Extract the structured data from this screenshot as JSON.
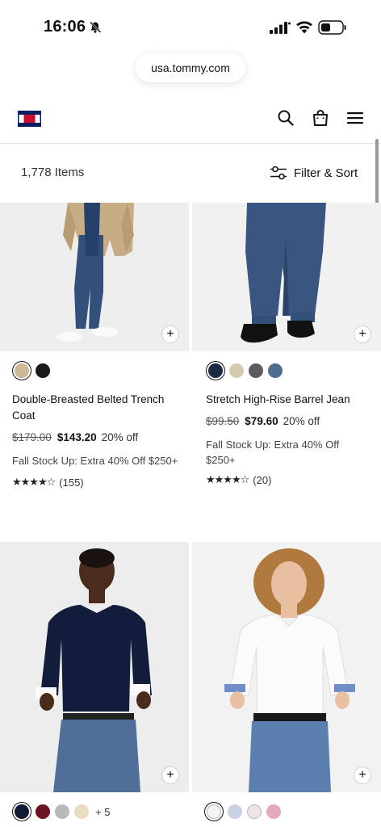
{
  "status_bar": {
    "time": "16:06"
  },
  "browser": {
    "url": "usa.tommy.com"
  },
  "results": {
    "count": "1,778 Items",
    "filter_label": "Filter & Sort"
  },
  "icons": {
    "search": "search-icon",
    "bag": "bag-icon",
    "menu": "menu-icon",
    "add": "plus-icon"
  },
  "colors": {
    "brand_navy": "#0a1d5c",
    "brand_red": "#cc0c2f"
  },
  "products": [
    {
      "name": "Double-Breasted Belted Trench Coat",
      "swatches": [
        "#cdb894",
        "#1a1a1a"
      ],
      "original_price": "$179.00",
      "sale_price": "$143.20",
      "discount": "20% off",
      "promo": "Fall Stock Up: Extra 40% Off $250+",
      "stars": "★★★★☆",
      "rating": 4.5,
      "reviews": "(155)",
      "add": "+"
    },
    {
      "name": "Stretch High-Rise Barrel Jean",
      "swatches": [
        "#1c2a44",
        "#d6cbb0",
        "#5c5c5c",
        "#4f6d8e"
      ],
      "original_price": "$99.50",
      "sale_price": "$79.60",
      "discount": "20% off",
      "promo": "Fall Stock Up: Extra 40% Off $250+",
      "stars": "★★★★☆",
      "rating": 4.5,
      "reviews": "(20)",
      "add": "+"
    },
    {
      "swatches": [
        "#101a35",
        "#6b1320",
        "#b9b9b9",
        "#eadcc0"
      ],
      "more": "+ 5",
      "add": "+"
    },
    {
      "swatches": [
        "#f4f4f4",
        "#c9d2e4",
        "#efe4ea",
        "#e6a8bd"
      ],
      "add": "+"
    }
  ]
}
